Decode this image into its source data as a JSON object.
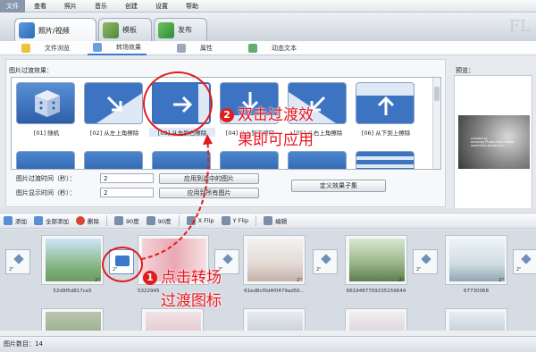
{
  "menu": [
    "文件",
    "查看",
    "照片",
    "音乐",
    "创建",
    "设置",
    "帮助"
  ],
  "main_tabs": [
    {
      "label": "照片/视频"
    },
    {
      "label": "模板"
    },
    {
      "label": "发布"
    }
  ],
  "brand_text": "FL",
  "sub_tabs": [
    "文件浏览",
    "转场效果",
    "属性",
    "动态文本"
  ],
  "effects_label": "图片过渡效果：",
  "effects": [
    {
      "label": "[01] 随机"
    },
    {
      "label": "[02] 从左上角擦除"
    },
    {
      "label": "[03] 从左到右擦除"
    },
    {
      "label": "[04] 从上到下擦除"
    },
    {
      "label": "[05] 从右上角擦除"
    },
    {
      "label": "[06] 从下到上擦除"
    }
  ],
  "form": {
    "transition_time_label": "图片过渡时间（秒）：",
    "transition_time_value": "2",
    "display_time_label": "图片显示时间（秒）：",
    "display_time_value": "2",
    "apply_selected": "应用到选中的图片",
    "apply_all": "应用到所有图片",
    "define_subset": "定义效果子集"
  },
  "preview": {
    "label": "预览：",
    "line1": "created by",
    "line2": "Amazing Photo Flash Maker",
    "line3": "www.flash-photo.com"
  },
  "toolbar": [
    "添加",
    "全部添加",
    "删除",
    "90度",
    "90度",
    "X Flip",
    "Y Flip",
    "编辑"
  ],
  "photos": [
    {
      "name": "52d9f5d817ce5",
      "duration": "2\""
    },
    {
      "name": "5322945",
      "duration": "2\""
    },
    {
      "name": "61ed8cf0d4f0479ad50...",
      "duration": "2\""
    },
    {
      "name": "6619487709235159644",
      "duration": "2\""
    },
    {
      "name": "67730068",
      "duration": "2\""
    }
  ],
  "transition_durations": [
    "2\"",
    "2\"",
    "2\"",
    "2\"",
    "2\"",
    "2\""
  ],
  "status": "图片数目：14",
  "annotations": {
    "step1_number": "1",
    "step1_line1": "点击转场",
    "step1_line2": "过渡图标",
    "step2_number": "2",
    "step2_line1": "双击过渡效",
    "step2_line2": "果即可应用"
  },
  "colors": {
    "accent": "#3a7bd5",
    "annotation": "#e11c1c"
  }
}
